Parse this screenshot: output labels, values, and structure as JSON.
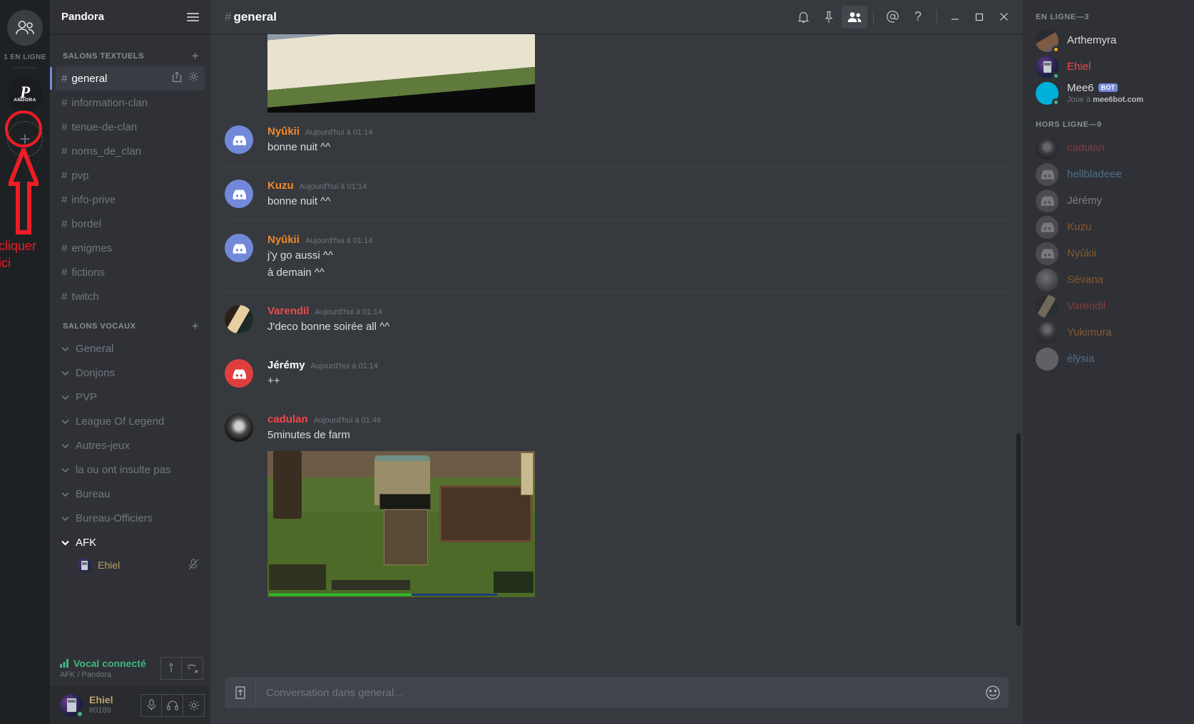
{
  "guild_rail": {
    "home_icon": "friends-icon",
    "online_label": "1 EN LIGNE",
    "server_logo_main": "P",
    "server_logo_sub": "ANDORA",
    "add_server_label": "+"
  },
  "annotation": {
    "text_line1": "cliquer",
    "text_line2": "ici",
    "color": "#ee1c25"
  },
  "sidebar": {
    "guild_name": "Pandora",
    "text_category": "SALONS TEXTUELS",
    "voice_category": "SALONS VOCAUX",
    "add_channel_label": "+",
    "text_channels": [
      {
        "name": "general",
        "active": true
      },
      {
        "name": "information-clan",
        "active": false
      },
      {
        "name": "tenue-de-clan",
        "active": false
      },
      {
        "name": "noms_de_clan",
        "active": false
      },
      {
        "name": "pvp",
        "active": false
      },
      {
        "name": "info-prive",
        "active": false
      },
      {
        "name": "bordel",
        "active": false
      },
      {
        "name": "enigmes",
        "active": false
      },
      {
        "name": "fictions",
        "active": false
      },
      {
        "name": "twitch",
        "active": false
      }
    ],
    "voice_channels": [
      {
        "name": "General",
        "active": false
      },
      {
        "name": "Donjons",
        "active": false
      },
      {
        "name": "PVP",
        "active": false
      },
      {
        "name": "League Of Legend",
        "active": false
      },
      {
        "name": "Autres-jeux",
        "active": false
      },
      {
        "name": "la ou ont insulte pas",
        "active": false
      },
      {
        "name": "Bureau",
        "active": false
      },
      {
        "name": "Bureau-Officiers",
        "active": false
      },
      {
        "name": "AFK",
        "active": true
      }
    ],
    "voice_member": "Ehiel"
  },
  "voice_panel": {
    "status": "Vocal connecté",
    "location": "AFK / Pandora",
    "info_icon": "info-icon",
    "disconnect_icon": "disconnect-call-icon"
  },
  "user_panel": {
    "username": "Ehiel",
    "discriminator": "#0189",
    "mic_icon": "microphone-icon",
    "headset_icon": "headset-icon",
    "settings_icon": "gear-icon"
  },
  "topbar": {
    "hash": "#",
    "channel": "general",
    "icons": [
      "bell-icon",
      "pin-icon",
      "members-icon",
      "at-mention-icon",
      "help-icon"
    ],
    "window_minimize": "–",
    "window_maximize": "□",
    "window_close": "✕"
  },
  "messages": [
    {
      "author": "Nyûkii",
      "color": "#f0892a",
      "timestamp": "Aujourd'hui à 01:14",
      "lines": [
        "bonne nuit ^^"
      ],
      "avatar": "discord-default",
      "first": true
    },
    {
      "author": "Kuzu",
      "color": "#f0892a",
      "timestamp": "Aujourd'hui à 01:14",
      "lines": [
        "bonne nuit ^^"
      ],
      "avatar": "discord-default",
      "first": false
    },
    {
      "author": "Nyûkii",
      "color": "#f0892a",
      "timestamp": "Aujourd'hui à 01:14",
      "lines": [
        "j'y go aussi ^^",
        "à demain ^^"
      ],
      "avatar": "discord-default",
      "first": false
    },
    {
      "author": "Varendil",
      "color": "#f04747",
      "timestamp": "Aujourd'hui à 01:14",
      "lines": [
        "J'deco bonne soirée all ^^"
      ],
      "avatar": "varendil-photo",
      "first": false
    },
    {
      "author": "Jérémy",
      "color": "#ffffff",
      "timestamp": "Aujourd'hui à 01:14",
      "lines": [
        "++"
      ],
      "avatar": "discord-default-red",
      "first": false
    },
    {
      "author": "cadulan",
      "color": "#f04747",
      "timestamp": "Aujourd'hui à 01:46",
      "lines": [
        "5minutes de farm"
      ],
      "avatar": "cadulan-photo",
      "first": false,
      "attachment": "game-screenshot"
    }
  ],
  "input": {
    "placeholder": "Conversation dans general...",
    "upload_icon": "upload-icon",
    "emoji_icon": "emoji-icon"
  },
  "members": {
    "online_header": "EN LIGNE—3",
    "offline_header": "HORS LIGNE—9",
    "online": [
      {
        "name": "Arthemyra",
        "color": "#dcddde",
        "status": "idle",
        "avatar": "arthemyra"
      },
      {
        "name": "Ehiel",
        "color": "#f04747",
        "status": "online",
        "avatar": "ehiel"
      },
      {
        "name": "Mee6",
        "color": "#dcddde",
        "status": "online",
        "avatar": "mee6",
        "bot": "BOT",
        "activity_prefix": "Joue à ",
        "activity": "mee6bot.com"
      }
    ],
    "offline": [
      {
        "name": "cadulan",
        "color": "#f04747",
        "avatar": "cadulan"
      },
      {
        "name": "hellbladeee",
        "color": "#7ab8e8",
        "avatar": "generic"
      },
      {
        "name": "Jérémy",
        "color": "#dcddde",
        "avatar": "generic"
      },
      {
        "name": "Kuzu",
        "color": "#f0892a",
        "avatar": "generic"
      },
      {
        "name": "Nyûkii",
        "color": "#f0892a",
        "avatar": "generic"
      },
      {
        "name": "Sévana",
        "color": "#f0892a",
        "avatar": "sevana"
      },
      {
        "name": "Varendil",
        "color": "#f04747",
        "avatar": "varendil"
      },
      {
        "name": "Yukimura",
        "color": "#f0892a",
        "avatar": "yukimura"
      },
      {
        "name": "élÿsia",
        "color": "#7ab8e8",
        "avatar": "elysia"
      }
    ]
  }
}
